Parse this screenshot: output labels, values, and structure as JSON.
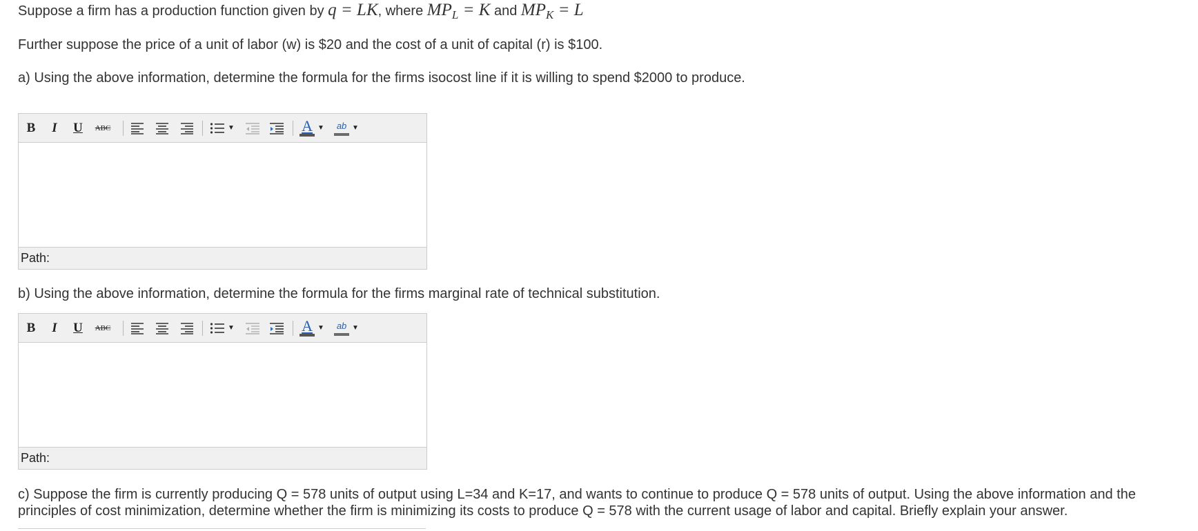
{
  "question": {
    "intro_prefix": "Suppose a firm has a production function given by ",
    "formula_q": "q = LK",
    "where_text": ", where ",
    "formula_mpl": "MP",
    "formula_mpl_sub": "L",
    "formula_mpl_rest": " = K",
    "and_text": " and ",
    "formula_mpk": "MP",
    "formula_mpk_sub": "K",
    "formula_mpk_rest": " = L",
    "prices_text": "Further suppose the price of a unit of labor (w) is $20  and the cost of a unit of capital (r) is $100.",
    "part_a": "a)  Using the above information, determine the formula for the firms isocost line if it is willing to spend $2000 to produce.",
    "part_b": "b)  Using the above information, determine the formula for the firms marginal rate of technical substitution.",
    "part_c_line1": "c) Suppose the firm is currently producing Q = 578 units of output using L=34 and K=17, and wants to continue to produce Q = 578 units of output.  Using the above information and the",
    "part_c_line2": "principles of cost minimization, determine whether the firm is minimizing its costs to produce Q = 578 with the current usage of labor and capital.  Briefly explain your answer."
  },
  "editor_a": {
    "path_label": "Path:",
    "content": ""
  },
  "editor_b": {
    "path_label": "Path:",
    "content": ""
  },
  "toolbar": {
    "bold": "B",
    "italic": "I",
    "underline": "U",
    "strikethrough": "ABC",
    "font_color": "A",
    "highlight": "ab"
  },
  "colors": {
    "toolbar_bg": "#f0f0f0",
    "border": "#cccccc",
    "text": "#333333",
    "font_color_bar": "#333333",
    "highlight_bar": "#6b6b6b"
  }
}
